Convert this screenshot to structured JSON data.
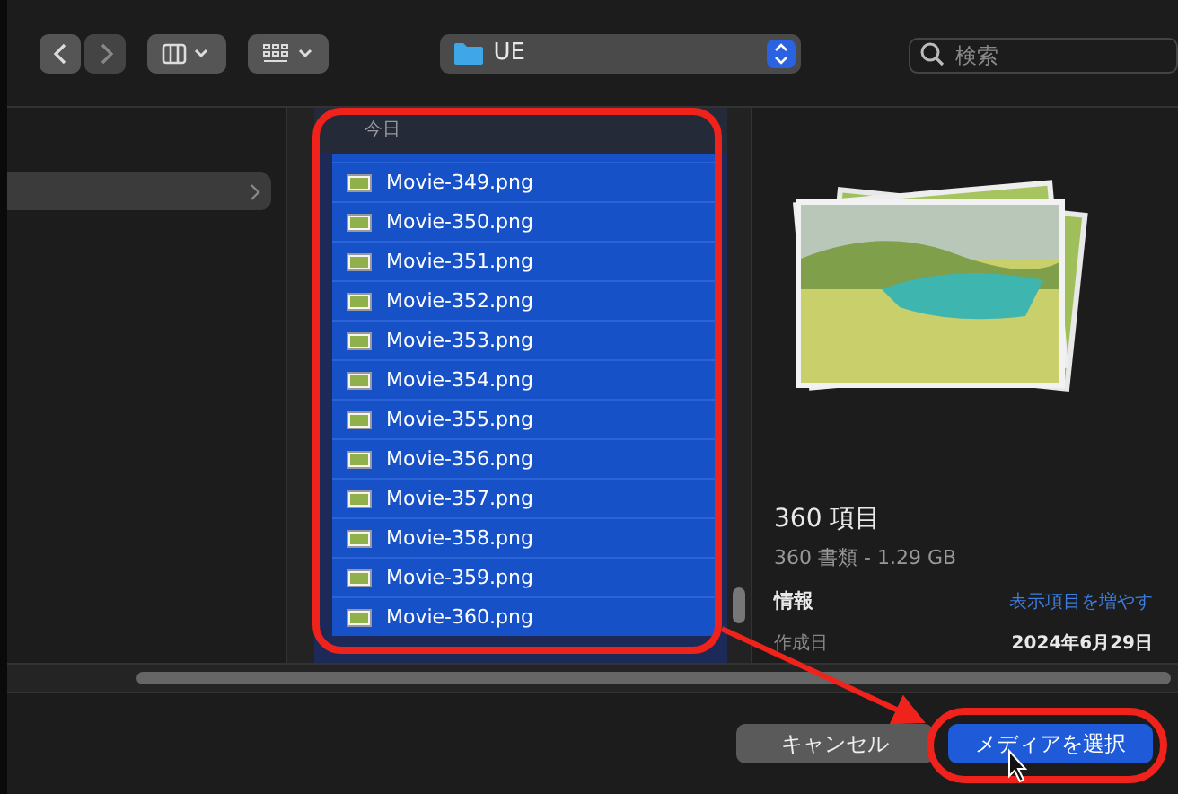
{
  "toolbar": {
    "location": "UE",
    "search": {
      "placeholder": "検索"
    }
  },
  "file_list": {
    "group_header": "今日",
    "rows": [
      {
        "name": "Movie-349.png",
        "selected": true
      },
      {
        "name": "Movie-350.png",
        "selected": true
      },
      {
        "name": "Movie-351.png",
        "selected": true
      },
      {
        "name": "Movie-352.png",
        "selected": true
      },
      {
        "name": "Movie-353.png",
        "selected": true
      },
      {
        "name": "Movie-354.png",
        "selected": true
      },
      {
        "name": "Movie-355.png",
        "selected": true
      },
      {
        "name": "Movie-356.png",
        "selected": true
      },
      {
        "name": "Movie-357.png",
        "selected": true
      },
      {
        "name": "Movie-358.png",
        "selected": true
      },
      {
        "name": "Movie-359.png",
        "selected": true
      },
      {
        "name": "Movie-360.png",
        "selected": true
      }
    ]
  },
  "preview": {
    "title": "360 項目",
    "subtitle": "360 書類 - 1.29 GB",
    "info_label": "情報",
    "more_link": "表示項目を増やす",
    "fields": [
      {
        "label": "作成日",
        "value": "2024年6月29日"
      }
    ]
  },
  "buttons": [
    {
      "label": "キャンセル",
      "kind": "secondary"
    },
    {
      "label": "メディアを選択",
      "kind": "primary"
    }
  ]
}
